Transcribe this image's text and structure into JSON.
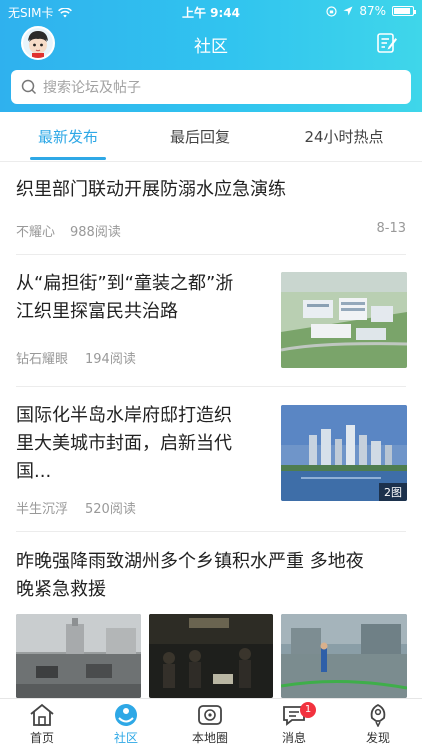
{
  "status": {
    "carrier": "无SIM卡",
    "time": "上午 9:44",
    "battery": "87%",
    "battery_level": 0.87
  },
  "header": {
    "title": "社区"
  },
  "search": {
    "placeholder": "搜索论坛及帖子"
  },
  "tabs": [
    {
      "label": "最新发布",
      "active": true
    },
    {
      "label": "最后回复",
      "active": false
    },
    {
      "label": "24小时热点",
      "active": false
    }
  ],
  "articles": [
    {
      "title": "织里部门联动开展防溺水应急演练",
      "author": "不耀心",
      "reads": "988阅读",
      "date": "8-13"
    },
    {
      "title_line1": "从“扁担街”到“童装之都”浙",
      "title_line2": "江织里探富民共治路",
      "author": "钻石耀眼",
      "reads": "194阅读"
    },
    {
      "title_line1": "国际化半岛水岸府邸打造织",
      "title_line2": "里大美城市封面，启新当代",
      "title_line3": "国...",
      "author": "半生沉浮",
      "reads": "520阅读",
      "image_badge": "2图"
    },
    {
      "title_line1": "昨晚强降雨致湖州多个乡镇积水严重 多地夜",
      "title_line2": "晚紧急救援"
    }
  ],
  "tabbar": [
    {
      "label": "首页",
      "icon": "home-icon"
    },
    {
      "label": "社区",
      "icon": "community-icon"
    },
    {
      "label": "本地圈",
      "icon": "local-circle-icon"
    },
    {
      "label": "消息",
      "icon": "message-icon",
      "badge": "1"
    },
    {
      "label": "发现",
      "icon": "discover-icon"
    }
  ],
  "colors": {
    "accent": "#2ea8e6",
    "header_start": "#2fb1ee",
    "header_end": "#3fd6ea",
    "badge": "#f2323e"
  }
}
